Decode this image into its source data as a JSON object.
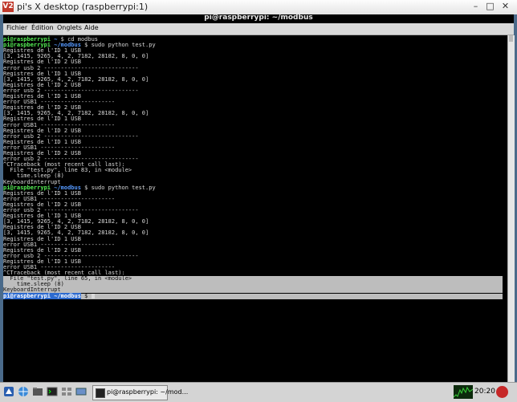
{
  "vnc": {
    "title": "pi's X desktop (raspberrypi:1)",
    "minimize": "–",
    "maximize": "□",
    "close": "✕",
    "logo": "V2"
  },
  "terminal": {
    "title": "pi@raspberrypi: ~/modbus",
    "menu": [
      "Fichier",
      "Édition",
      "Onglets",
      "Aide"
    ],
    "lines": [
      {
        "user": "pi@raspberrypi",
        "path": "~",
        "text": " $ cd modbus"
      },
      {
        "user": "pi@raspberrypi",
        "path": "~/modbus",
        "text": " $ sudo python test.py"
      },
      {
        "text": "Registres de l'ID 1 USB"
      },
      {
        "text": "[3, 1415, 9265, 4, 2, 7182, 28182, 8, 0, 0]"
      },
      {
        "text": "Registres de l'ID 2 USB"
      },
      {
        "text": "error usb 2 ----------------------------"
      },
      {
        "text": "Registres de l'ID 1 USB"
      },
      {
        "text": "[3, 1415, 9265, 4, 2, 7182, 28182, 8, 0, 0]"
      },
      {
        "text": "Registres de l'ID 2 USB"
      },
      {
        "text": "error usb 2 ----------------------------"
      },
      {
        "text": "Registres de l'ID 1 USB"
      },
      {
        "text": "error USB1 ----------------------"
      },
      {
        "text": "Registres de l'ID 2 USB"
      },
      {
        "text": "[3, 1415, 9265, 4, 2, 7182, 28182, 8, 0, 0]"
      },
      {
        "text": "Registres de l'ID 1 USB"
      },
      {
        "text": "error USB1 ----------------------"
      },
      {
        "text": "Registres de l'ID 2 USB"
      },
      {
        "text": "error usb 2 ----------------------------"
      },
      {
        "text": "Registres de l'ID 1 USB"
      },
      {
        "text": "error USB1 ----------------------"
      },
      {
        "text": "Registres de l'ID 2 USB"
      },
      {
        "text": "error usb 2 ----------------------------"
      },
      {
        "text": "^CTraceback (most recent call last):"
      },
      {
        "text": "  File \"test.py\", line 83, in <module>"
      },
      {
        "text": "    time.sleep (8)"
      },
      {
        "text": "KeyboardInterrupt"
      },
      {
        "user": "pi@raspberrypi",
        "path": "~/modbus",
        "text": " $ sudo python test.py"
      },
      {
        "text": "Registres de l'ID 1 USB"
      },
      {
        "text": "error USB1 ----------------------"
      },
      {
        "text": "Registres de l'ID 2 USB"
      },
      {
        "text": "error usb 2 ----------------------------"
      },
      {
        "text": "Registres de l'ID 1 USB"
      },
      {
        "text": "[3, 1415, 9265, 4, 2, 7182, 28182, 8, 0, 0]"
      },
      {
        "text": "Registres de l'ID 2 USB"
      },
      {
        "text": "[3, 1415, 9265, 4, 2, 7182, 28182, 8, 0, 0]"
      },
      {
        "text": "Registres de l'ID 1 USB"
      },
      {
        "text": "error USB1 ----------------------"
      },
      {
        "text": "Registres de l'ID 2 USB"
      },
      {
        "text": "error usb 2 ----------------------------"
      },
      {
        "text": "Registres de l'ID 1 USB"
      },
      {
        "text": "error USB1 ----------------------"
      },
      {
        "text": "^CTraceback (most recent call last):"
      },
      {
        "text": "  File \"test.py\", line 65, in <module>",
        "sel": true
      },
      {
        "text": "    time.sleep (8)",
        "sel": true
      },
      {
        "text": "KeyboardInterrupt",
        "sel": true
      },
      {
        "user": "pi@raspberrypi",
        "path": "~/modbus",
        "text": " $ ",
        "cursor": true,
        "sel": true
      }
    ]
  },
  "taskbar": {
    "window_label": "pi@raspberrypi: ~/mod...",
    "clock": "20:20"
  },
  "colors": {
    "terminal_bg": "#000000",
    "terminal_fg": "#d8d8d8",
    "prompt_user": "#55ee55",
    "prompt_path": "#5599ff",
    "selection": "#bdbdbd"
  }
}
